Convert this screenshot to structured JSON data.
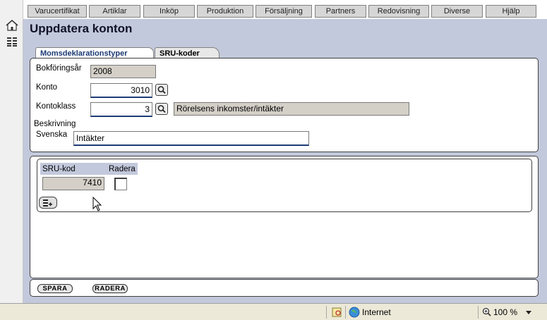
{
  "nav": {
    "tabs": [
      "Varucertifikat",
      "Artiklar",
      "Inköp",
      "Produktion",
      "Försäljning",
      "Partners",
      "Redovisning",
      "Diverse",
      "Hjälp"
    ]
  },
  "page": {
    "title": "Uppdatera konton"
  },
  "form_tabs": {
    "moms": "Momsdeklarationstyper",
    "sru": "SRU-koder"
  },
  "form": {
    "bokforingsar_label": "Bokföringsår",
    "bokforingsar_value": "2008",
    "konto_label": "Konto",
    "konto_value": "3010",
    "kontoklass_label": "Kontoklass",
    "kontoklass_value": "3",
    "kontoklass_desc": "Rörelsens inkomster/intäkter",
    "beskrivning_label": "Beskrivning",
    "svenska_label": "Svenska",
    "svenska_value": "Intäkter"
  },
  "sru": {
    "col_code": "SRU-kod",
    "col_delete": "Radera",
    "rows": [
      {
        "code": "7410",
        "delete": false
      }
    ]
  },
  "actions": {
    "save": "SPARA",
    "delete": "RADERA"
  },
  "status": {
    "zone": "Internet",
    "zoom": "100 %"
  },
  "icons": [
    "home-icon",
    "list-icon",
    "magnifier-icon",
    "add-row-icon",
    "lock-icon",
    "globe-icon",
    "zoom-icon",
    "dropdown-arrow-icon"
  ]
}
